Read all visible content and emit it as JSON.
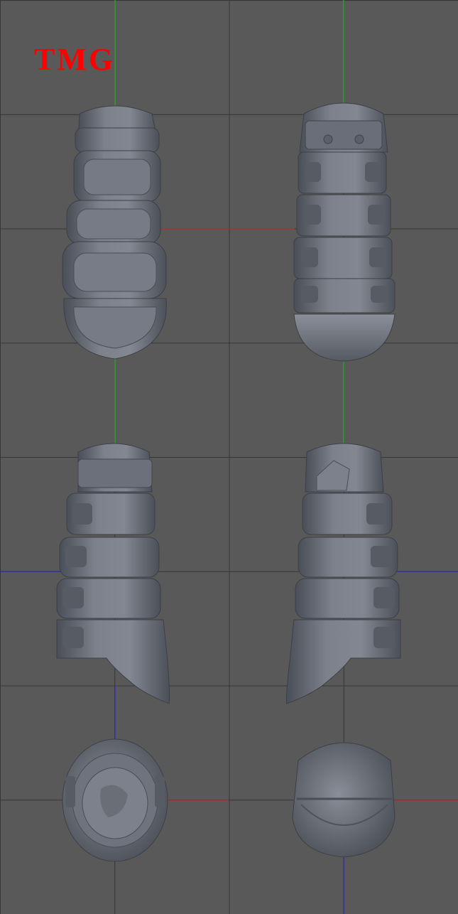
{
  "watermark": {
    "text": "TMG",
    "color": "#ff0000"
  },
  "colors": {
    "background": "#595959",
    "grid": "#323232",
    "axis_x": "#d21e1e",
    "axis_y": "#19c819",
    "axis_z": "#2323d2",
    "model": "#6e727c"
  },
  "views": [
    {
      "name": "front-view",
      "axes": [
        "x",
        "y"
      ]
    },
    {
      "name": "back-view",
      "axes": [
        "x",
        "y"
      ]
    },
    {
      "name": "left-side-view",
      "axes": [
        "z",
        "y"
      ]
    },
    {
      "name": "right-side-view",
      "axes": [
        "z",
        "y"
      ]
    },
    {
      "name": "top-view",
      "axes": [
        "x",
        "z"
      ]
    },
    {
      "name": "bottom-view",
      "axes": [
        "x",
        "z"
      ]
    }
  ]
}
